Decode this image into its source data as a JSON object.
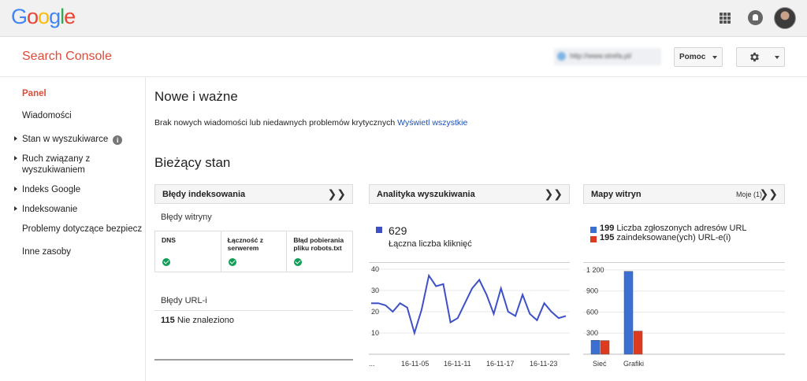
{
  "header": {
    "logo_letters": [
      {
        "ch": "G",
        "color": "#4285F4"
      },
      {
        "ch": "o",
        "color": "#EA4335"
      },
      {
        "ch": "o",
        "color": "#FBBC05"
      },
      {
        "ch": "g",
        "color": "#4285F4"
      },
      {
        "ch": "l",
        "color": "#34A853"
      },
      {
        "ch": "e",
        "color": "#EA4335"
      }
    ],
    "icons": [
      "apps-icon",
      "notifications-icon",
      "avatar"
    ]
  },
  "appbar": {
    "title": "Search Console",
    "site_url": "http://www.strefa.pl/",
    "help_label": "Pomoc",
    "settings_icon": "gear-icon"
  },
  "sidebar": {
    "items": [
      {
        "label": "Panel",
        "active": true,
        "arrow": false
      },
      {
        "label": "Wiadomości",
        "active": false,
        "arrow": false
      },
      {
        "label": "Stan w wyszukiwarce",
        "active": false,
        "arrow": true,
        "info": true
      },
      {
        "label": "Ruch związany z",
        "label2": "wyszukiwaniem",
        "active": false,
        "arrow": true
      },
      {
        "label": "Indeks Google",
        "active": false,
        "arrow": true
      },
      {
        "label": "Indeksowanie",
        "active": false,
        "arrow": true
      },
      {
        "label": "Problemy dotyczące bezpiecz",
        "active": false,
        "arrow": false
      },
      {
        "label": "Inne zasoby",
        "active": false,
        "arrow": false
      }
    ]
  },
  "main": {
    "new_heading": "Nowe i ważne",
    "message": "Brak nowych wiadomości lub niedawnych problemów krytycznych",
    "message_link": "Wyświetl wszystkie",
    "current_heading": "Bieżący stan"
  },
  "cards": {
    "indexing": {
      "title": "Błędy indeksowania",
      "site_errors_label": "Błędy witryny",
      "columns": [
        "DNS",
        "Łączność z serwerem",
        "Błąd pobierania pliku robots.txt"
      ],
      "url_errors_label": "Błędy URL-i",
      "not_found_count": "115",
      "not_found_label": "Nie znaleziono"
    },
    "analytics": {
      "title": "Analityka wyszukiwania",
      "clicks_value": "629",
      "clicks_label": "Łączna liczba kliknięć",
      "series_color": "#3e50c8"
    },
    "sitemaps": {
      "title": "Mapy witryn",
      "mine_label": "Moje (1)",
      "submitted_count": "199",
      "submitted_label": "Liczba zgłoszonych adresów URL",
      "indexed_count": "195",
      "indexed_label": "zaindeksowane(ych) URL-e(i)",
      "submitted_color": "#3b6fd1",
      "indexed_color": "#dc3b1f"
    }
  },
  "chart_data": [
    {
      "type": "line",
      "title": "",
      "xlabel": "",
      "ylabel": "",
      "ylim": [
        0,
        40
      ],
      "yticks": [
        10,
        20,
        30,
        40
      ],
      "x_tick_labels": [
        "...",
        "16-11-05",
        "16-11-11",
        "16-11-17",
        "16-11-23"
      ],
      "series": [
        {
          "values": [
            24,
            24,
            23,
            20,
            24,
            22,
            10,
            21,
            37,
            32,
            33,
            15,
            17,
            24,
            31,
            35,
            28,
            19,
            31,
            20,
            18,
            28,
            19,
            16,
            24,
            20,
            17,
            18
          ]
        }
      ]
    },
    {
      "type": "bar",
      "title": "",
      "categories": [
        "Sieć",
        "Grafiki"
      ],
      "ylim": [
        0,
        1300
      ],
      "yticks": [
        "1 200",
        "900",
        "600",
        "300"
      ],
      "ytick_values": [
        1200,
        900,
        600,
        300
      ],
      "series": [
        {
          "name": "Liczba zgłoszonych adresów URL",
          "values": [
            199,
            1180
          ]
        },
        {
          "name": "zaindeksowane(ych) URL-e(i)",
          "values": [
            195,
            330
          ]
        }
      ]
    }
  ]
}
